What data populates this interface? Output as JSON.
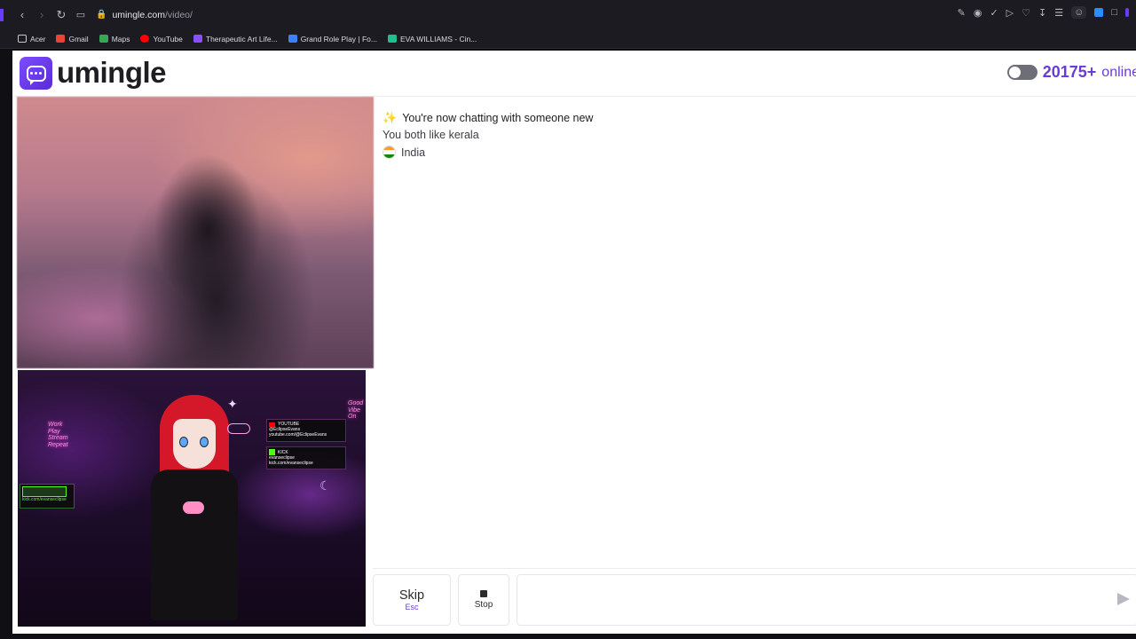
{
  "browser": {
    "url_host": "umingle.com",
    "url_path": "/video/",
    "bookmarks": [
      {
        "label": "Acer",
        "icon": "folder-icon",
        "color": "#c9c9cf"
      },
      {
        "label": "Gmail",
        "icon": "gmail-icon",
        "color": "#ea4335"
      },
      {
        "label": "Maps",
        "icon": "maps-icon",
        "color": "#34a853"
      },
      {
        "label": "YouTube",
        "icon": "youtube-icon",
        "color": "#ff0000"
      },
      {
        "label": "Therapeutic Art Life...",
        "icon": "art-icon",
        "color": "#8a4dff"
      },
      {
        "label": "Grand Role Play | Fo...",
        "icon": "game-icon",
        "color": "#3b82f6"
      },
      {
        "label": "EVA WILLIAMS - Cin...",
        "icon": "film-icon",
        "color": "#1fbf8f"
      }
    ]
  },
  "header": {
    "logo_text": "umingle",
    "online_count": "20175+",
    "online_label": "online"
  },
  "chat": {
    "title": "You're now chatting with someone new",
    "common_interest": "You both like kerala",
    "country": "India"
  },
  "controls": {
    "skip_label": "Skip",
    "skip_hint": "Esc",
    "stop_label": "Stop",
    "message_placeholder": ""
  },
  "stream_overlay": {
    "neon_left": "Work\nPlay\nStream\nRepeat",
    "neon_right": "Good\nVibe\nOn",
    "youtube_label": "YOUTUBE",
    "youtube_handle": "@EclipseEvans",
    "youtube_url": "youtube.com/@EclipseEvans",
    "kick_label": "KICK",
    "kick_handle": "evanseclipse",
    "kick_url": "kick.com/evanseclipse",
    "kick_small_url": "kick.com/evanseclipse"
  },
  "colors": {
    "brand": "#6a3cd6",
    "brand_gradient_start": "#7c4dff",
    "browser_bg": "#1c1b22"
  }
}
